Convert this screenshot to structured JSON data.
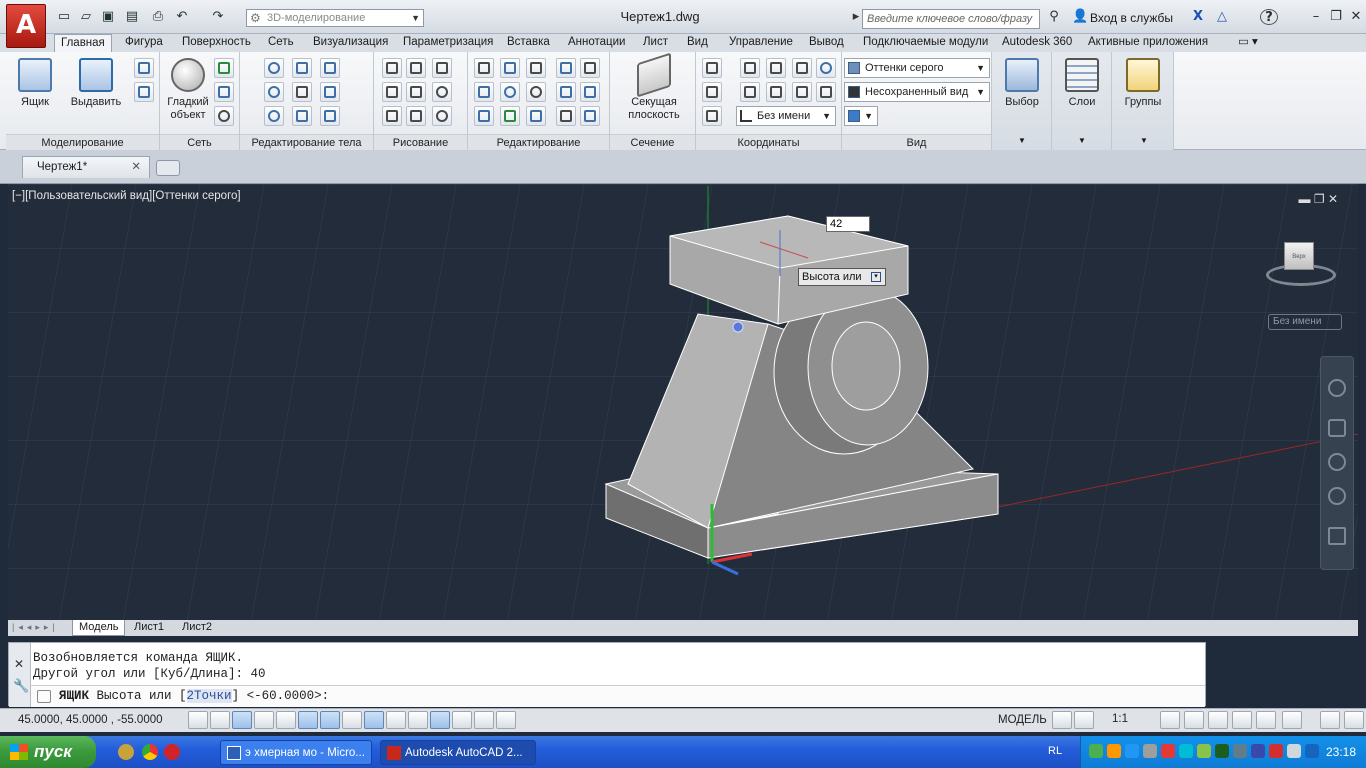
{
  "app": {
    "logo": "A",
    "document_title": "Чертеж1.dwg"
  },
  "toolbar": {
    "workspace": "3D-моделирование",
    "search_placeholder": "Введите ключевое слово/фразу",
    "sign_in": "Вход в службы",
    "help": "?"
  },
  "tabs": [
    "Главная",
    "Фигура",
    "Поверхность",
    "Сеть",
    "Визуализация",
    "Параметризация",
    "Вставка",
    "Аннотации",
    "Лист",
    "Вид",
    "Управление",
    "Вывод",
    "Подключаемые модули",
    "Autodesk 360",
    "Активные приложения"
  ],
  "ribbon": {
    "modeling": {
      "label": "Моделирование",
      "box": "Ящик",
      "extrude": "Выдавить"
    },
    "mesh": {
      "label": "Сеть",
      "smooth": "Гладкий объект"
    },
    "solid_edit": {
      "label": "Редактирование тела"
    },
    "draw": {
      "label": "Рисование"
    },
    "modify": {
      "label": "Редактирование"
    },
    "section": {
      "label": "Сечение",
      "plane": "Секущая плоскость"
    },
    "coords": {
      "label": "Координаты",
      "ucs_name": "Без имени"
    },
    "view": {
      "label": "Вид",
      "visual_style": "Оттенки серого",
      "view_name": "Несохраненный вид"
    },
    "selection": {
      "label": "Выбор"
    },
    "layers": {
      "label": "Слои"
    },
    "groups": {
      "label": "Группы"
    }
  },
  "file_tab": {
    "name": "Чертеж1*"
  },
  "viewport": {
    "label": "[−][Пользовательский вид][Оттенки серого]",
    "viewcube_face": "Верх",
    "ucs_name": "Без имени",
    "height_input": "42",
    "tooltip": "Высота или"
  },
  "layout_tabs": [
    "Модель",
    "Лист1",
    "Лист2"
  ],
  "command": {
    "history": [
      "Возобновляется команда ЯЩИК.",
      "Другой угол или [Куб/Длина]: 40"
    ],
    "prompt_cmd": "ЯЩИК",
    "prompt_pre": "Высота или [",
    "prompt_kw": "2Точки",
    "prompt_post": "] <-60.0000>:"
  },
  "status": {
    "coords": "45.0000, 45.0000 , -55.0000",
    "model": "МОДЕЛЬ",
    "scale": "1:1"
  },
  "taskbar": {
    "start": "пуск",
    "windows": [
      "э хмерная мо - Micro...",
      "Autodesk AutoCAD 2..."
    ],
    "lang": "RL",
    "clock": "23:18"
  }
}
